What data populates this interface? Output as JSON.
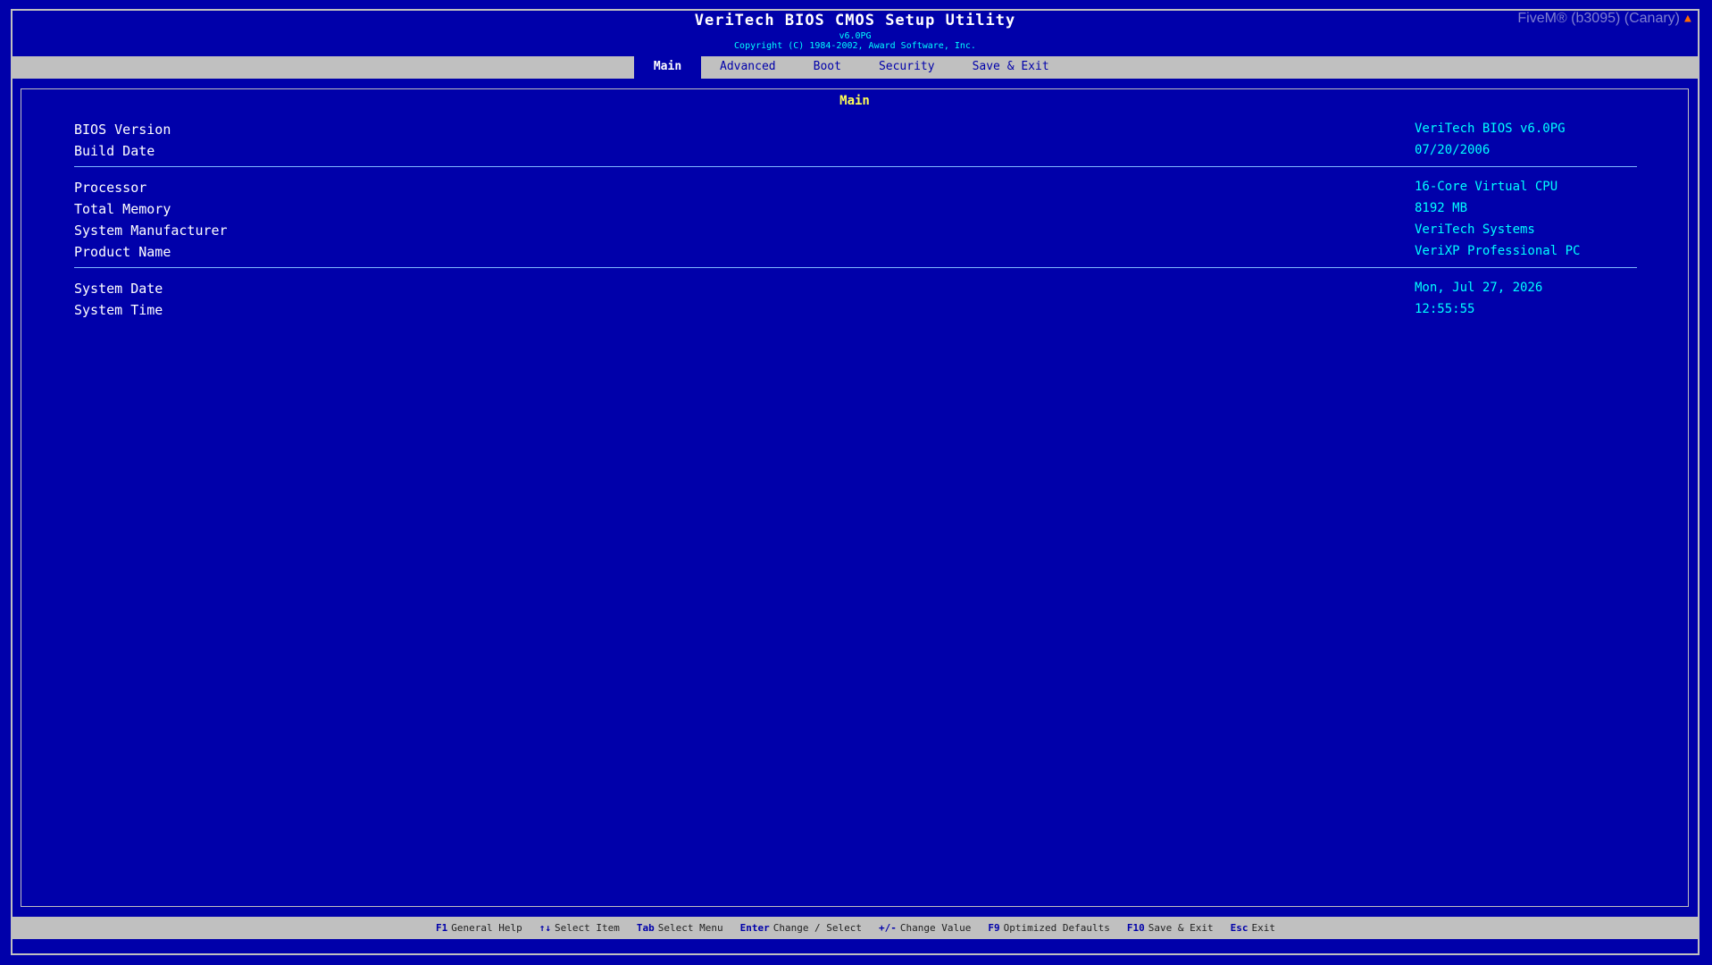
{
  "header": {
    "title": "VeriTech BIOS CMOS Setup Utility",
    "version": "v6.0PG",
    "copyright": "Copyright (C) 1984-2002, Award Software, Inc.",
    "watermark": "FiveM® (b3095) (Canary)"
  },
  "tabs": [
    {
      "label": "Main",
      "active": true
    },
    {
      "label": "Advanced",
      "active": false
    },
    {
      "label": "Boot",
      "active": false
    },
    {
      "label": "Security",
      "active": false
    },
    {
      "label": "Save & Exit",
      "active": false
    }
  ],
  "panel": {
    "title": "Main",
    "groups": [
      [
        {
          "label": "BIOS Version",
          "value": "VeriTech BIOS v6.0PG"
        },
        {
          "label": "Build Date",
          "value": "07/20/2006"
        }
      ],
      [
        {
          "label": "Processor",
          "value": "16-Core Virtual CPU"
        },
        {
          "label": "Total Memory",
          "value": "8192 MB"
        },
        {
          "label": "System Manufacturer",
          "value": "VeriTech Systems"
        },
        {
          "label": "Product Name",
          "value": "VeriXP Professional PC"
        }
      ],
      [
        {
          "label": "System Date",
          "value": "Mon, Jul 27, 2026"
        },
        {
          "label": "System Time",
          "value": "12:55:55"
        }
      ]
    ]
  },
  "hints": [
    {
      "key": "F1",
      "desc": "General Help"
    },
    {
      "key": "↑↓",
      "desc": "Select Item"
    },
    {
      "key": "Tab",
      "desc": "Select Menu"
    },
    {
      "key": "Enter",
      "desc": "Change / Select"
    },
    {
      "key": "+/-",
      "desc": "Change Value"
    },
    {
      "key": "F9",
      "desc": "Optimized Defaults"
    },
    {
      "key": "F10",
      "desc": "Save & Exit"
    },
    {
      "key": "Esc",
      "desc": "Exit"
    }
  ],
  "colors": {
    "background": "#0000aa",
    "value": "#00ffff",
    "panel_title": "#ffff55",
    "bar": "#c0c0c0"
  },
  "icons": {
    "watermark_icon": "fivem-logo-icon"
  }
}
